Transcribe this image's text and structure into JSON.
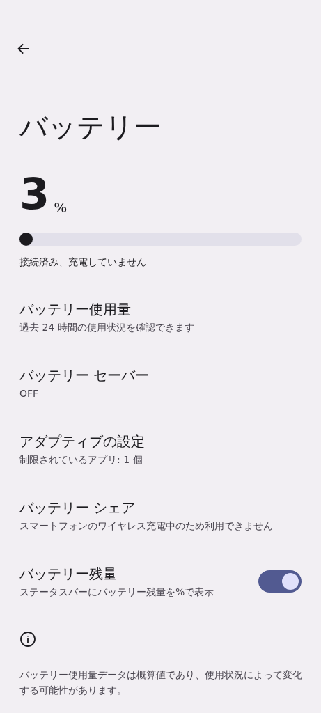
{
  "title": "バッテリー",
  "battery": {
    "percent": "3",
    "unit": "%",
    "level": 0.03,
    "status": "接続済み、充電していません"
  },
  "items": [
    {
      "kind": "link",
      "title": "バッテリー使用量",
      "subtitle": "過去 24 時間の使用状況を確認できます"
    },
    {
      "kind": "link",
      "title": "バッテリー セーバー",
      "subtitle": "OFF"
    },
    {
      "kind": "link",
      "title": "アダプティブの設定",
      "subtitle": "制限されているアプリ: 1 個"
    },
    {
      "kind": "link",
      "title": "バッテリー シェア",
      "subtitle": "スマートフォンのワイヤレス充電中のため利用できません"
    },
    {
      "kind": "toggle",
      "title": "バッテリー残量",
      "subtitle": "ステータスバーにバッテリー残量を%で表示",
      "on": true
    }
  ],
  "footer": "バッテリー使用量データは概算値であり、使用状況によって変化する可能性があります。"
}
